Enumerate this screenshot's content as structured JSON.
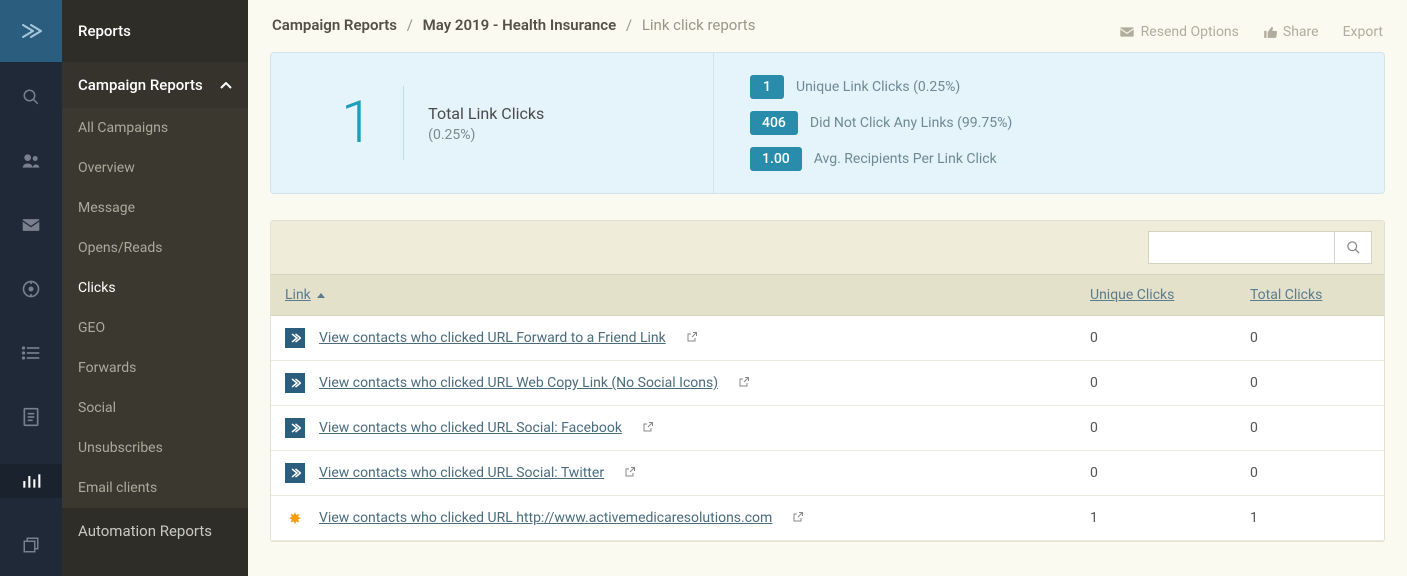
{
  "sidebar": {
    "title": "Reports",
    "group_label": "Campaign Reports",
    "items": [
      "All Campaigns",
      "Overview",
      "Message",
      "Opens/Reads",
      "Clicks",
      "GEO",
      "Forwards",
      "Social",
      "Unsubscribes",
      "Email clients"
    ],
    "active_item": "Clicks",
    "other_groups": [
      "Automation Reports"
    ]
  },
  "breadcrumb": {
    "a": "Campaign Reports",
    "b": "May 2019 - Health Insurance",
    "c": "Link click reports"
  },
  "top_actions": {
    "resend": "Resend Options",
    "share": "Share",
    "export": "Export"
  },
  "summary": {
    "big_value": "1",
    "big_title": "Total Link Clicks",
    "big_pct": "(0.25%)",
    "stats": [
      {
        "badge": "1",
        "label": "Unique Link Clicks (0.25%)"
      },
      {
        "badge": "406",
        "label": "Did Not Click Any Links (99.75%)"
      },
      {
        "badge": "1.00",
        "label": "Avg. Recipients Per Link Click"
      }
    ]
  },
  "table": {
    "headers": {
      "link": "Link",
      "unique": "Unique Clicks",
      "total": "Total Clicks"
    },
    "rows": [
      {
        "icon": "arrow",
        "text": "View contacts who clicked URL Forward to a Friend Link ",
        "unique": "0",
        "total": "0"
      },
      {
        "icon": "arrow",
        "text": "View contacts who clicked URL Web Copy Link (No Social Icons) ",
        "unique": "0",
        "total": "0"
      },
      {
        "icon": "arrow",
        "text": "View contacts who clicked URL Social: Facebook ",
        "unique": "0",
        "total": "0"
      },
      {
        "icon": "arrow",
        "text": "View contacts who clicked URL Social: Twitter ",
        "unique": "0",
        "total": "0"
      },
      {
        "icon": "star",
        "text": "View contacts who clicked URL http://www.activemedicaresolutions.com ",
        "unique": "1",
        "total": "1"
      }
    ]
  }
}
